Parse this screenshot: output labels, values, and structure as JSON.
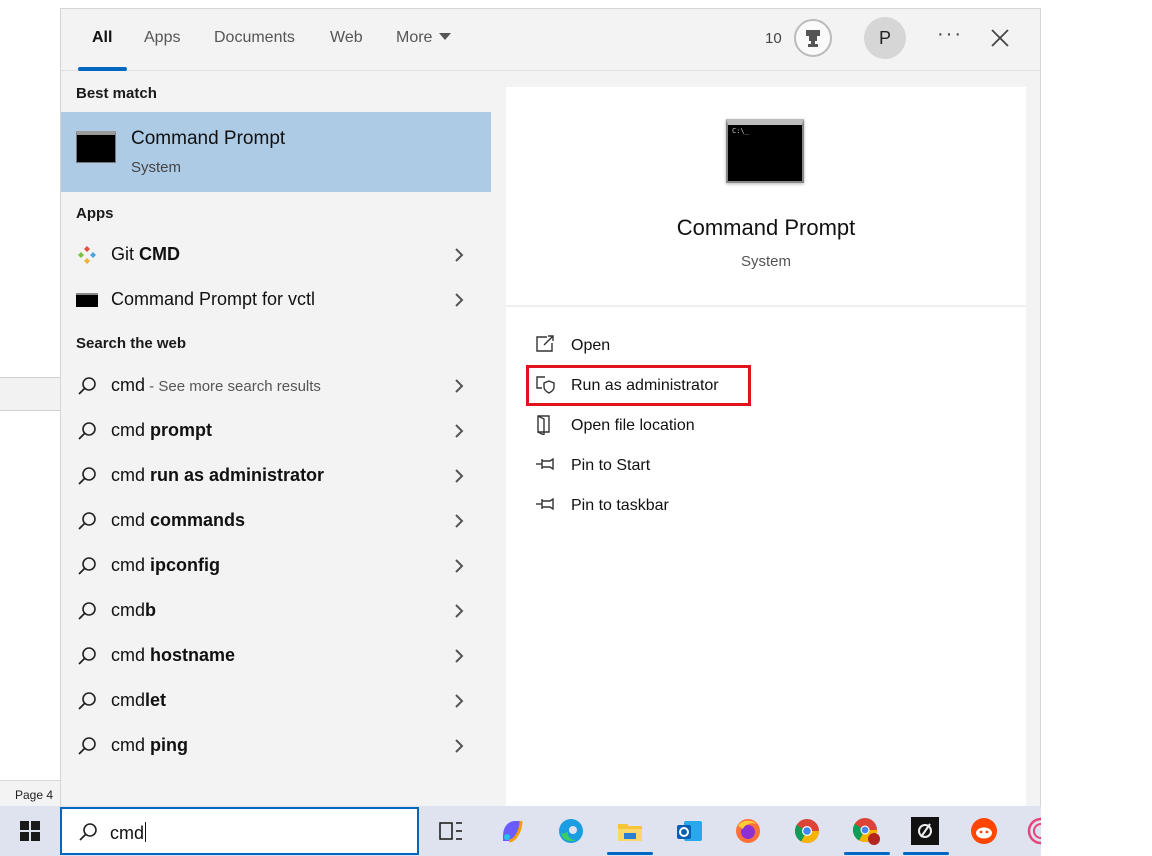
{
  "background": {
    "status_text": "Page 4"
  },
  "tabs": [
    {
      "label": "All"
    },
    {
      "label": "Apps"
    },
    {
      "label": "Documents"
    },
    {
      "label": "Web"
    },
    {
      "label": "More"
    }
  ],
  "header": {
    "points": "10",
    "avatar_initial": "P",
    "more_options": "···"
  },
  "sections": {
    "best_match": "Best match",
    "apps": "Apps",
    "web": "Search the web"
  },
  "best_match": {
    "title": "Command Prompt",
    "subtitle": "System"
  },
  "apps": [
    {
      "plain": "Git ",
      "bold": "CMD"
    },
    {
      "plain": "Command Prompt for vctl",
      "bold": ""
    }
  ],
  "web_results": [
    {
      "plain": "cmd",
      "bold": "",
      "hint": " - See more search results"
    },
    {
      "plain": "cmd ",
      "bold": "prompt",
      "hint": ""
    },
    {
      "plain": "cmd ",
      "bold": "run as administrator",
      "hint": ""
    },
    {
      "plain": "cmd ",
      "bold": "commands",
      "hint": ""
    },
    {
      "plain": "cmd ",
      "bold": "ipconfig",
      "hint": ""
    },
    {
      "plain": "cmd",
      "bold": "b",
      "hint": ""
    },
    {
      "plain": "cmd ",
      "bold": "hostname",
      "hint": ""
    },
    {
      "plain": "cmd",
      "bold": "let",
      "hint": ""
    },
    {
      "plain": "cmd ",
      "bold": "ping",
      "hint": ""
    }
  ],
  "preview": {
    "title": "Command Prompt",
    "subtitle": "System",
    "icon_text": "C:\\_",
    "actions": [
      {
        "label": "Open",
        "icon": "open-icon"
      },
      {
        "label": "Run as administrator",
        "icon": "shield-admin-icon"
      },
      {
        "label": "Open file location",
        "icon": "folder-location-icon"
      },
      {
        "label": "Pin to Start",
        "icon": "pin-icon"
      },
      {
        "label": "Pin to taskbar",
        "icon": "pin-icon"
      }
    ]
  },
  "taskbar": {
    "search_value": "cmd",
    "apps": [
      "task-view-icon",
      "copilot-icon",
      "edge-icon",
      "file-explorer-icon",
      "outlook-icon",
      "firefox-icon",
      "chrome-icon",
      "chrome-profile-icon",
      "vctl-icon",
      "reddit-icon",
      "app-icon"
    ]
  },
  "colors": {
    "accent": "#0067c0",
    "selected": "#aecbe6",
    "highlight": "#e0121c"
  }
}
